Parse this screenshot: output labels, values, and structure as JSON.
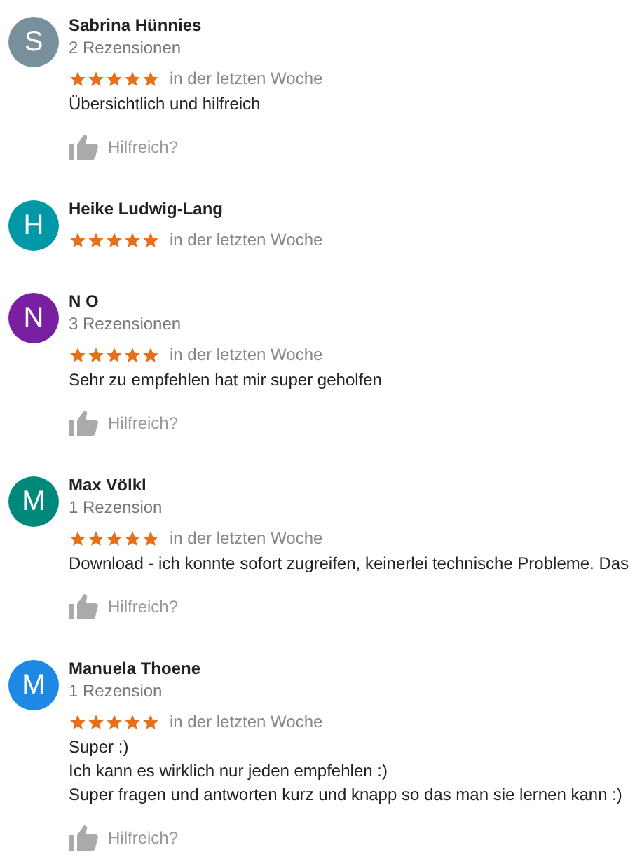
{
  "reviews": [
    {
      "initial": "S",
      "color": "#78909c",
      "name": "Sabrina Hünnies",
      "count": "2 Rezensionen",
      "stars": 5,
      "time": "in der letzten Woche",
      "text_lines": [
        "Übersichtlich und hilfreich"
      ],
      "helpful": "Hilfreich?"
    },
    {
      "initial": "H",
      "color": "#0097a7",
      "name": "Heike Ludwig-Lang",
      "stars": 5,
      "time": "in der letzten Woche"
    },
    {
      "initial": "N",
      "color": "#7b1fa2",
      "name": "N O",
      "count": "3 Rezensionen",
      "stars": 5,
      "time": "in der letzten Woche",
      "text_lines": [
        "Sehr zu empfehlen hat mir super geholfen"
      ],
      "helpful": "Hilfreich?"
    },
    {
      "initial": "M",
      "color": "#00897b",
      "name": "Max Völkl",
      "count": "1 Rezension",
      "stars": 5,
      "time": "in der letzten Woche",
      "text_lines": [
        "Download - ich konnte sofort zugreifen, keinerlei technische Probleme. Das"
      ],
      "helpful": "Hilfreich?"
    },
    {
      "initial": "M",
      "color": "#1e88e5",
      "name": "Manuela Thoene",
      "count": "1 Rezension",
      "stars": 5,
      "time": "in der letzten Woche",
      "text_lines": [
        "Super :)",
        "Ich kann es wirklich nur jeden empfehlen :)",
        "Super fragen und antworten kurz und knapp so das man sie lernen kann :)"
      ],
      "helpful": "Hilfreich?"
    }
  ]
}
